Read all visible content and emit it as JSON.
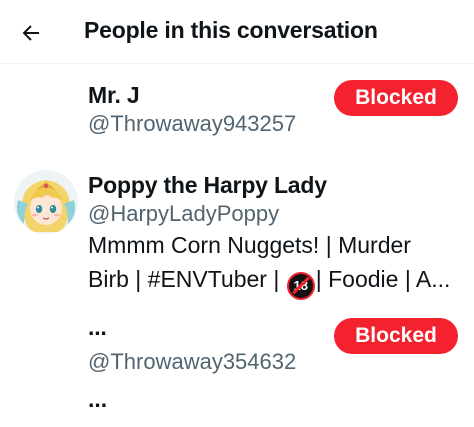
{
  "header": {
    "title": "People in this conversation",
    "back_icon": "arrow-left-icon"
  },
  "people": [
    {
      "name": "Mr. J",
      "handle": "@Throwaway943257",
      "button": "Blocked"
    },
    {
      "name": "Poppy the Harpy Lady",
      "handle": "@HarpyLadyPoppy",
      "bio_part1": "Mmmm Corn Nuggets! | Murder",
      "bio_part2": "Birb | #ENVTuber |",
      "bio_badge": "18",
      "bio_part3": "| Foodie | A...",
      "avatar_icon": "harpy-avatar-icon"
    },
    {
      "name": "...",
      "handle": "@Throwaway354632",
      "bio": "...",
      "button": "Blocked"
    }
  ],
  "colors": {
    "blocked": "#f4212e",
    "secondary_text": "#536471",
    "primary_text": "#0f1419"
  }
}
